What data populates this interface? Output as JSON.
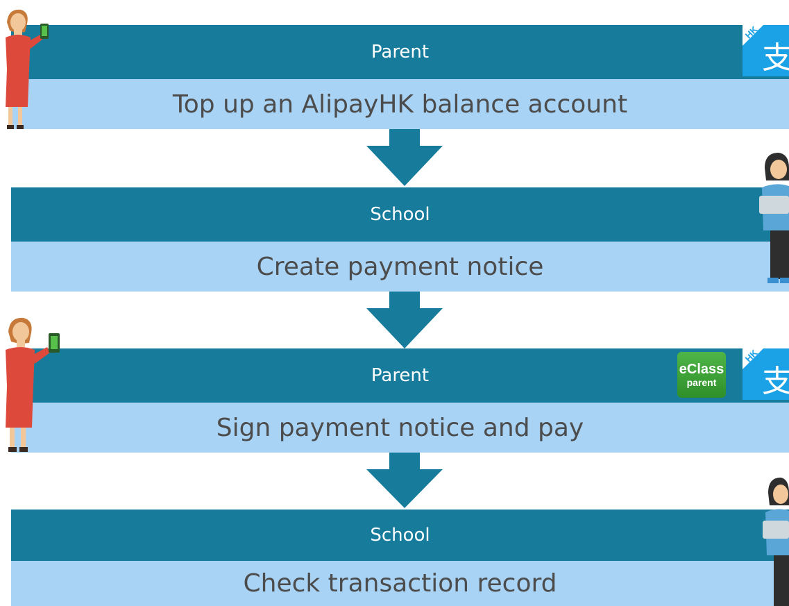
{
  "steps": [
    {
      "actor": "Parent",
      "action": "Top up an  AlipayHK balance account"
    },
    {
      "actor": "School",
      "action": "Create payment notice"
    },
    {
      "actor": "Parent",
      "action": "Sign payment notice and pay"
    },
    {
      "actor": "School",
      "action": "Check transaction record"
    }
  ],
  "logos": {
    "alipay_tag": "HK",
    "alipay_glyph": "支",
    "eclass_line1": "eClass",
    "eclass_line2": "parent"
  },
  "colors": {
    "dark_band": "#177c9c",
    "light_band": "#a8d3f5",
    "arrow": "#177c9c",
    "alipay_blue": "#1aa1e6",
    "eclass_green": "#3aa437"
  }
}
